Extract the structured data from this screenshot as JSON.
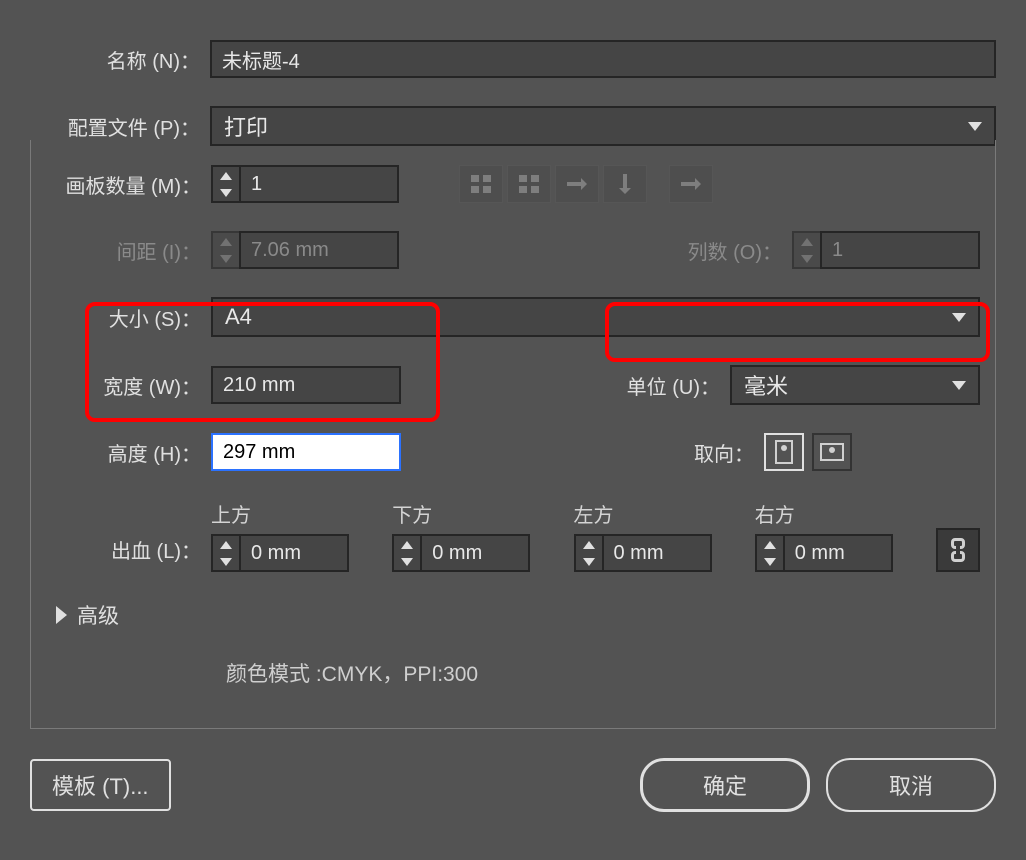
{
  "labels": {
    "name": "名称 (N)：",
    "profile": "配置文件 (P)：",
    "artboards": "画板数量 (M)：",
    "spacing": "间距 (I)：",
    "columns": "列数 (O)：",
    "size": "大小 (S)：",
    "width": "宽度 (W)：",
    "height": "高度 (H)：",
    "unit": "单位 (U)：",
    "orientation": "取向：",
    "bleed": "出血 (L)：",
    "top": "上方",
    "bottom": "下方",
    "left": "左方",
    "right": "右方",
    "advanced": "高级"
  },
  "values": {
    "name": "未标题-4",
    "profile": "打印",
    "artboards": "1",
    "spacing": "7.06 mm",
    "columns": "1",
    "size": "A4",
    "width": "210 mm",
    "height": "297 mm",
    "unit": "毫米",
    "bleed_top": "0 mm",
    "bleed_bottom": "0 mm",
    "bleed_left": "0 mm",
    "bleed_right": "0 mm",
    "color_mode": "颜色模式 :CMYK，PPI:300"
  },
  "buttons": {
    "template": "模板 (T)...",
    "ok": "确定",
    "cancel": "取消"
  }
}
